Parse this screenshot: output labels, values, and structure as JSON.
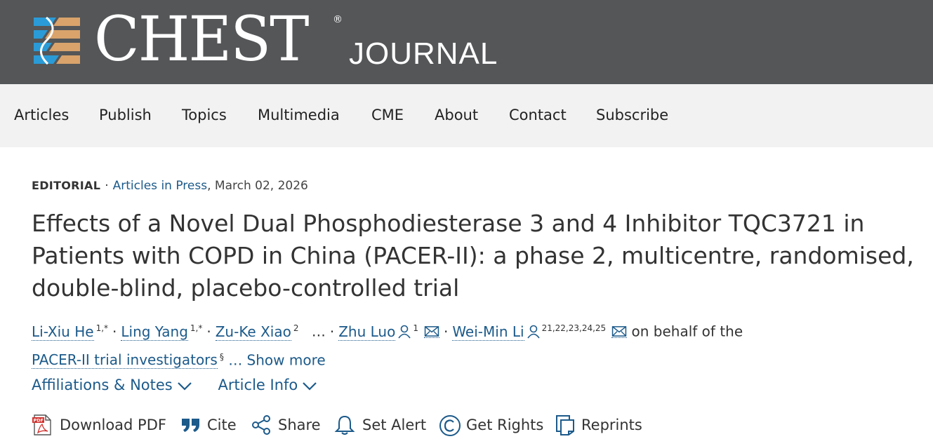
{
  "brand": {
    "name": "CHEST",
    "registered": "®",
    "sub": "JOURNAL",
    "colors": {
      "masthead": "#545658",
      "blue": "#2a9bd7",
      "tan": "#d9a36b"
    }
  },
  "nav": {
    "items": [
      "Articles",
      "Publish",
      "Topics",
      "Multimedia",
      "CME",
      "About",
      "Contact",
      "Subscribe"
    ]
  },
  "article": {
    "type": "EDITORIAL",
    "sep": "·",
    "status": "Articles in Press",
    "date": ", March 02, 2026",
    "title": "Effects of a Novel Dual Phosphodiesterase 3 and 4 Inhibitor TQC3721 in Patients with COPD in China (PACER-II): a phase 2, multicentre, randomised, double-blind, placebo-controlled trial",
    "authors": {
      "a1": {
        "name": "Li-Xiu He",
        "sup": "1,*"
      },
      "a2": {
        "name": "Ling Yang",
        "sup": "1,*"
      },
      "a3": {
        "name": "Zu-Ke Xiao",
        "sup": "2"
      },
      "ellipsis": "…",
      "a4": {
        "name": "Zhu Luo",
        "sup": "1"
      },
      "a5": {
        "name": "Wei-Min Li",
        "sup": "21,22,23,24,25"
      },
      "behalf": " on behalf of the",
      "group": "PACER-II trial investigators",
      "group_sup": "§",
      "show_more": "… Show more"
    },
    "toggles": {
      "affiliations": "Affiliations & Notes",
      "info": "Article Info"
    },
    "actions": {
      "pdf": "Download PDF",
      "cite": "Cite",
      "share": "Share",
      "alert": "Set Alert",
      "rights": "Get Rights",
      "reprints": "Reprints"
    },
    "icons": {
      "pdf": "pdf-icon",
      "cite": "quote-icon",
      "share": "share-icon",
      "alert": "bell-icon",
      "rights": "copyright-icon",
      "reprints": "reprints-icon",
      "person": "person-icon",
      "mail": "mail-icon",
      "chevron": "chevron-down-icon"
    }
  }
}
